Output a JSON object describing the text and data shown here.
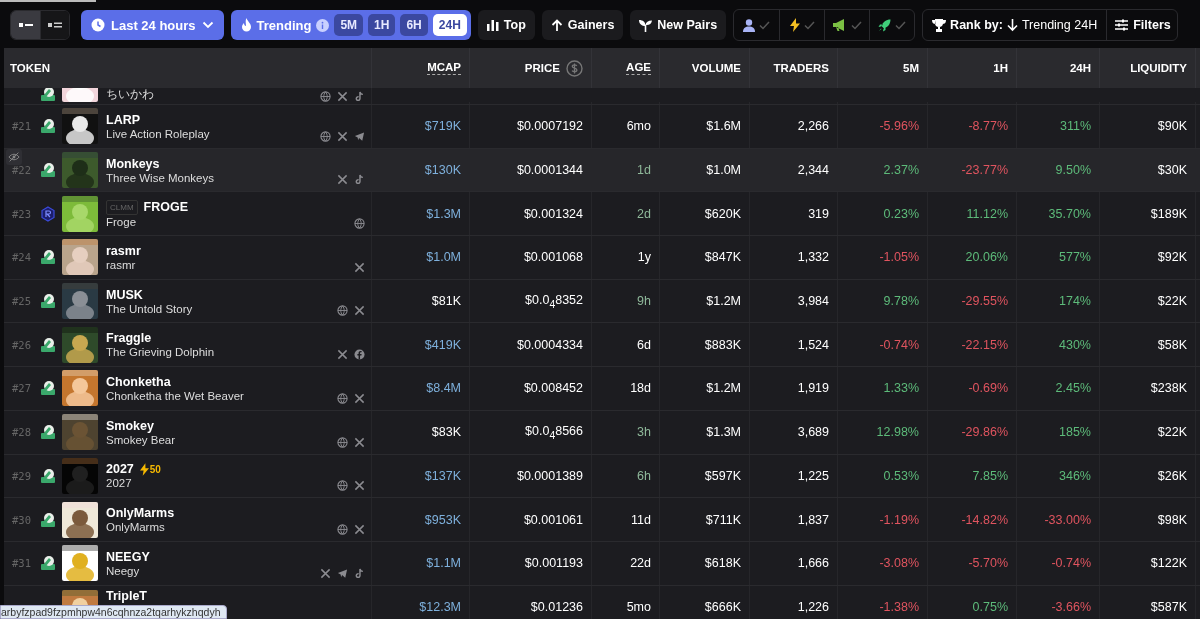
{
  "toolbar": {
    "views": [
      {
        "kind": "compact",
        "selected": true
      },
      {
        "kind": "list",
        "selected": false
      }
    ],
    "range": {
      "label": "Last 24 hours"
    },
    "trending": {
      "label": "Trending",
      "timeframes": [
        {
          "label": "5M",
          "selected": false
        },
        {
          "label": "1H",
          "selected": false
        },
        {
          "label": "6H",
          "selected": false
        },
        {
          "label": "24H",
          "selected": true
        }
      ]
    },
    "buttons": [
      {
        "kind": "top",
        "label": "Top"
      },
      {
        "kind": "gainers",
        "label": "Gainers"
      },
      {
        "kind": "new",
        "label": "New Pairs"
      }
    ],
    "toggles": [
      {
        "kind": "user",
        "checked": false
      },
      {
        "kind": "bolt",
        "checked": false
      },
      {
        "kind": "megaphone",
        "checked": false
      },
      {
        "kind": "rocket",
        "checked": false
      }
    ],
    "rank": {
      "label": "Rank by:",
      "value": "Trending 24H"
    },
    "filters": {
      "label": "Filters"
    }
  },
  "table": {
    "columns": [
      {
        "label": "TOKEN",
        "dotted": false
      },
      {
        "label": "MCAP",
        "dotted": true
      },
      {
        "label": "PRICE",
        "dotted": false
      },
      {
        "label": "AGE",
        "dotted": true
      },
      {
        "label": "VOLUME",
        "dotted": false
      },
      {
        "label": "TRADERS",
        "dotted": false
      },
      {
        "label": "5M",
        "dotted": false
      },
      {
        "label": "1H",
        "dotted": false
      },
      {
        "label": "24H",
        "dotted": false
      },
      {
        "label": "LIQUIDITY",
        "dotted": false
      }
    ],
    "rows": [
      {
        "kind": "partial_top",
        "subtitle": "ちいかわ",
        "dex": {
          "kind": "swap"
        },
        "socials": [
          {
            "kind": "web"
          },
          {
            "kind": "x"
          },
          {
            "kind": "tiktok"
          }
        ]
      },
      {
        "kind": "full",
        "rank": "#21",
        "dex": {
          "kind": "swap"
        },
        "name": "LARP",
        "subtitle": "Live Action Roleplay",
        "socials": [
          {
            "kind": "web"
          },
          {
            "kind": "x"
          },
          {
            "kind": "telegram"
          }
        ],
        "mcap": "$719K",
        "mcap_blue": true,
        "price": "$0.0007192",
        "age": "6mo",
        "age_recent": false,
        "volume": "$1.6M",
        "traders": "2,266",
        "changes": [
          {
            "text": "-5.96%",
            "up": false
          },
          {
            "text": "-8.77%",
            "up": false
          },
          {
            "text": "311%",
            "up": true
          }
        ],
        "liquidity": "$90K",
        "hovered": false
      },
      {
        "kind": "full",
        "rank": "#22",
        "dex": {
          "kind": "swap"
        },
        "name": "Monkeys",
        "subtitle": "Three Wise Monkeys",
        "socials": [
          {
            "kind": "x"
          },
          {
            "kind": "tiktok"
          }
        ],
        "mcap": "$130K",
        "mcap_blue": true,
        "price": "$0.0001344",
        "age": "1d",
        "age_recent": true,
        "volume": "$1.0M",
        "traders": "2,344",
        "changes": [
          {
            "text": "2.37%",
            "up": true
          },
          {
            "text": "-23.77%",
            "up": false
          },
          {
            "text": "9.50%",
            "up": true
          }
        ],
        "liquidity": "$30K",
        "hovered": true
      },
      {
        "kind": "full",
        "rank": "#23",
        "dex": {
          "kind": "ray"
        },
        "tag": "CLMM",
        "name": "FROGE",
        "subtitle": "Froge",
        "socials": [
          {
            "kind": "web"
          }
        ],
        "mcap": "$1.3M",
        "mcap_blue": true,
        "price": "$0.001324",
        "age": "2d",
        "age_recent": true,
        "volume": "$620K",
        "traders": "319",
        "changes": [
          {
            "text": "0.23%",
            "up": true
          },
          {
            "text": "11.12%",
            "up": true
          },
          {
            "text": "35.70%",
            "up": true
          }
        ],
        "liquidity": "$189K",
        "hovered": false
      },
      {
        "kind": "full",
        "rank": "#24",
        "dex": {
          "kind": "swap"
        },
        "name": "rasmr",
        "subtitle": "rasmr",
        "socials": [
          {
            "kind": "x"
          }
        ],
        "mcap": "$1.0M",
        "mcap_blue": true,
        "price": "$0.001068",
        "age": "1y",
        "age_recent": false,
        "volume": "$847K",
        "traders": "1,332",
        "changes": [
          {
            "text": "-1.05%",
            "up": false
          },
          {
            "text": "20.06%",
            "up": true
          },
          {
            "text": "577%",
            "up": true
          }
        ],
        "liquidity": "$92K",
        "hovered": false
      },
      {
        "kind": "full",
        "rank": "#25",
        "dex": {
          "kind": "swap"
        },
        "name": "MUSK",
        "subtitle": "The Untold Story",
        "socials": [
          {
            "kind": "web"
          },
          {
            "kind": "x"
          }
        ],
        "mcap": "$81K",
        "mcap_blue": false,
        "price": "$0.0$_{4}$8352",
        "age": "9h",
        "age_recent": true,
        "volume": "$1.2M",
        "traders": "3,984",
        "changes": [
          {
            "text": "9.78%",
            "up": true
          },
          {
            "text": "-29.55%",
            "up": false
          },
          {
            "text": "174%",
            "up": true
          }
        ],
        "liquidity": "$22K",
        "hovered": false
      },
      {
        "kind": "full",
        "rank": "#26",
        "dex": {
          "kind": "swap"
        },
        "name": "Fraggle",
        "subtitle": "The Grieving Dolphin",
        "socials": [
          {
            "kind": "x"
          },
          {
            "kind": "facebook"
          }
        ],
        "mcap": "$419K",
        "mcap_blue": true,
        "price": "$0.0004334",
        "age": "6d",
        "age_recent": false,
        "volume": "$883K",
        "traders": "1,524",
        "changes": [
          {
            "text": "-0.74%",
            "up": false
          },
          {
            "text": "-22.15%",
            "up": false
          },
          {
            "text": "430%",
            "up": true
          }
        ],
        "liquidity": "$58K",
        "hovered": false
      },
      {
        "kind": "full",
        "rank": "#27",
        "dex": {
          "kind": "swap"
        },
        "name": "Chonketha",
        "subtitle": "Chonketha the Wet Beaver",
        "socials": [
          {
            "kind": "web"
          },
          {
            "kind": "x"
          }
        ],
        "mcap": "$8.4M",
        "mcap_blue": true,
        "price": "$0.008452",
        "age": "18d",
        "age_recent": false,
        "volume": "$1.2M",
        "traders": "1,919",
        "changes": [
          {
            "text": "1.33%",
            "up": true
          },
          {
            "text": "-0.69%",
            "up": false
          },
          {
            "text": "2.45%",
            "up": true
          }
        ],
        "liquidity": "$238K",
        "hovered": false
      },
      {
        "kind": "full",
        "rank": "#28",
        "dex": {
          "kind": "swap"
        },
        "name": "Smokey",
        "subtitle": "Smokey Bear",
        "socials": [
          {
            "kind": "web"
          },
          {
            "kind": "x"
          }
        ],
        "mcap": "$83K",
        "mcap_blue": false,
        "price": "$0.0$_{4}$8566",
        "age": "3h",
        "age_recent": true,
        "volume": "$1.3M",
        "traders": "3,689",
        "changes": [
          {
            "text": "12.98%",
            "up": true
          },
          {
            "text": "-29.86%",
            "up": false
          },
          {
            "text": "185%",
            "up": true
          }
        ],
        "liquidity": "$22K",
        "hovered": false
      },
      {
        "kind": "full",
        "rank": "#29",
        "dex": {
          "kind": "swap"
        },
        "name": "2027",
        "boost": "50",
        "subtitle": "2027",
        "socials": [
          {
            "kind": "web"
          },
          {
            "kind": "x"
          }
        ],
        "mcap": "$137K",
        "mcap_blue": true,
        "price": "$0.0001389",
        "age": "6h",
        "age_recent": true,
        "volume": "$597K",
        "traders": "1,225",
        "changes": [
          {
            "text": "0.53%",
            "up": true
          },
          {
            "text": "7.85%",
            "up": true
          },
          {
            "text": "346%",
            "up": true
          }
        ],
        "liquidity": "$26K",
        "hovered": false
      },
      {
        "kind": "full",
        "rank": "#30",
        "dex": {
          "kind": "swap"
        },
        "name": "OnlyMarms",
        "subtitle": "OnlyMarms",
        "socials": [
          {
            "kind": "web"
          },
          {
            "kind": "x"
          }
        ],
        "mcap": "$953K",
        "mcap_blue": true,
        "price": "$0.001061",
        "age": "11d",
        "age_recent": false,
        "volume": "$711K",
        "traders": "1,837",
        "changes": [
          {
            "text": "-1.19%",
            "up": false
          },
          {
            "text": "-14.82%",
            "up": false
          },
          {
            "text": "-33.00%",
            "up": false
          }
        ],
        "liquidity": "$98K",
        "hovered": false
      },
      {
        "kind": "full",
        "rank": "#31",
        "dex": {
          "kind": "swap"
        },
        "name": "NEEGY",
        "subtitle": "Neegy",
        "socials": [
          {
            "kind": "x"
          },
          {
            "kind": "telegram"
          },
          {
            "kind": "tiktok"
          }
        ],
        "mcap": "$1.1M",
        "mcap_blue": true,
        "price": "$0.001193",
        "age": "22d",
        "age_recent": false,
        "volume": "$618K",
        "traders": "1,666",
        "changes": [
          {
            "text": "-3.08%",
            "up": false
          },
          {
            "text": "-5.70%",
            "up": false
          },
          {
            "text": "-0.74%",
            "up": false
          }
        ],
        "liquidity": "$122K",
        "hovered": false
      },
      {
        "kind": "full",
        "name": "TripleT",
        "mcap": "$12.3M",
        "mcap_blue": true,
        "price": "$0.01236",
        "age": "5mo",
        "age_recent": false,
        "volume": "$666K",
        "traders": "1,226",
        "changes": [
          {
            "text": "-1.38%",
            "up": false
          },
          {
            "text": "0.75%",
            "up": true
          },
          {
            "text": "-3.66%",
            "up": false
          }
        ],
        "liquidity": "$587K",
        "hovered": false
      }
    ]
  },
  "status_bar": {
    "text": "arbyfzpad9fzpmhpw4n6cqhnza2tqarhykzhqdyh"
  }
}
